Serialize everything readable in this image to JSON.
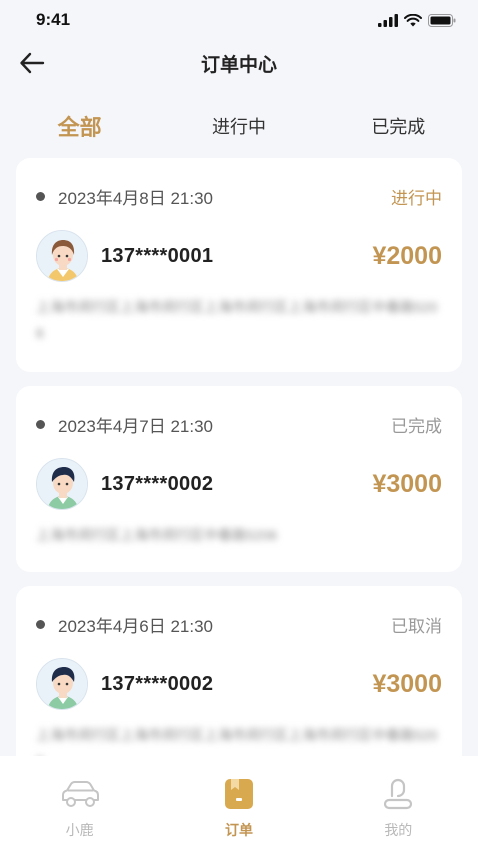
{
  "status_bar": {
    "time": "9:41"
  },
  "nav": {
    "title": "订单中心"
  },
  "tabs": [
    {
      "label": "全部"
    },
    {
      "label": "进行中"
    },
    {
      "label": "已完成"
    }
  ],
  "orders": [
    {
      "date": "2023年4月8日 21:30",
      "status": "进行中",
      "phone": "137****0001",
      "amount": "¥2000",
      "address": "上海市闵行区上海市闵行区上海市闵行区上海市闵行区中春路5206"
    },
    {
      "date": "2023年4月7日 21:30",
      "status": "已完成",
      "phone": "137****0002",
      "amount": "¥3000",
      "address": "上海市闵行区上海市闵行区中春路5206"
    },
    {
      "date": "2023年4月6日 21:30",
      "status": "已取消",
      "phone": "137****0002",
      "amount": "¥3000",
      "address": "上海市闵行区上海市闵行区上海市闵行区上海市闵行区中春路5206"
    }
  ],
  "tab_bar": [
    {
      "label": "小鹿",
      "icon": "car-icon"
    },
    {
      "label": "订单",
      "icon": "order-icon"
    },
    {
      "label": "我的",
      "icon": "profile-icon"
    }
  ],
  "colors": {
    "accent": "#c39552",
    "background": "#f5f6fa",
    "card": "#ffffff",
    "muted": "#999999"
  }
}
